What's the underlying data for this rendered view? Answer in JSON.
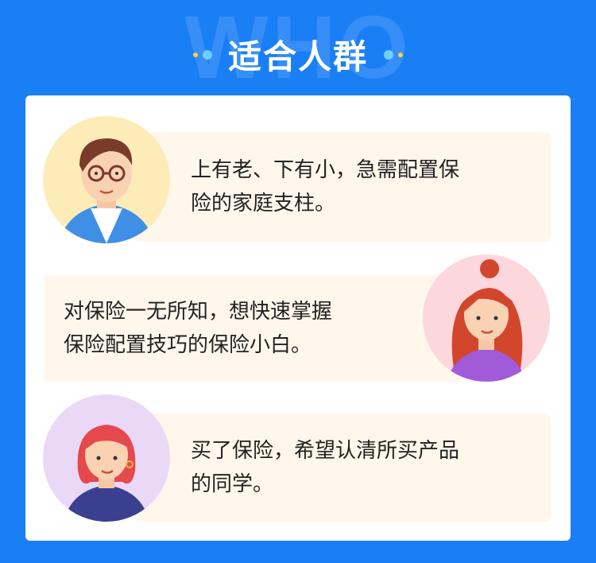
{
  "watermark": "WHO",
  "title": "适合人群",
  "items": [
    {
      "line1": "上有老、下有小，急需配置保",
      "line2": "险的家庭支柱。"
    },
    {
      "line1": "对保险一无所知，想快速掌握",
      "line2": "保险配置技巧的保险小白。"
    },
    {
      "line1": "买了保险，希望认清所买产品",
      "line2": "的同学。"
    }
  ],
  "colors": {
    "background": "#1a7ef5",
    "bubble": "#fff6ec",
    "accent_dot": "#ffd43b",
    "dot": "#6fd0ff"
  }
}
